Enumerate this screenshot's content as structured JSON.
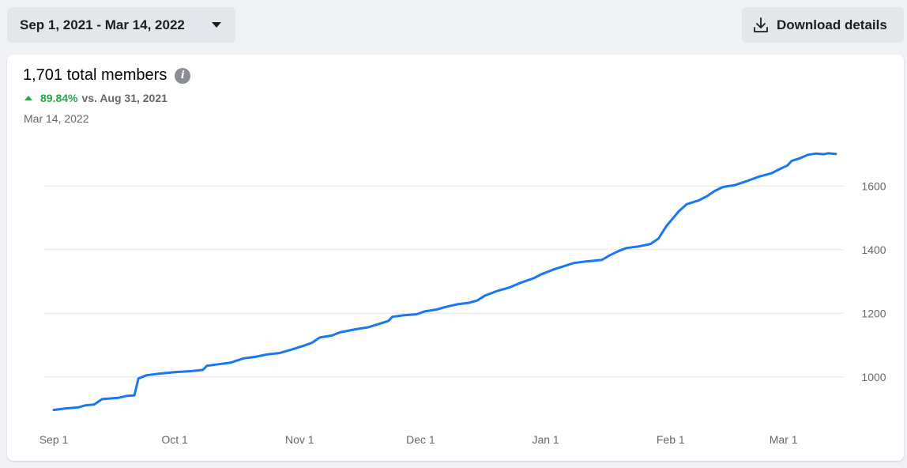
{
  "header": {
    "date_range": "Sep 1, 2021 - Mar 14, 2022",
    "download_label": "Download details"
  },
  "summary": {
    "total": "1,701 total members",
    "change_pct": "89.84%",
    "change_vs": "vs. Aug 31, 2021",
    "as_of": "Mar 14, 2022"
  },
  "icons": {
    "dropdown": "caret-down-icon",
    "download": "download-icon",
    "info": "info-icon",
    "trend": "up-arrow-icon"
  },
  "colors": {
    "line": "#1877f2",
    "positive": "#31a24c",
    "grid": "#e4e6eb"
  },
  "chart_data": {
    "type": "line",
    "title": "",
    "xlabel": "",
    "ylabel": "",
    "x_ticks": [
      "Sep 1",
      "Oct 1",
      "Nov 1",
      "Dec 1",
      "Jan 1",
      "Feb 1",
      "Mar 1"
    ],
    "y_ticks": [
      1000,
      1200,
      1400,
      1600
    ],
    "xlim": [
      "2021-09-01",
      "2022-03-14"
    ],
    "ylim": [
      895,
      1745
    ],
    "grid": true,
    "series": [
      {
        "name": "",
        "points": [
          [
            "2021-09-01",
            896
          ],
          [
            "2021-09-04",
            901
          ],
          [
            "2021-09-07",
            904
          ],
          [
            "2021-09-09",
            911
          ],
          [
            "2021-09-11",
            913
          ],
          [
            "2021-09-13",
            930
          ],
          [
            "2021-09-17",
            934
          ],
          [
            "2021-09-19",
            940
          ],
          [
            "2021-09-21",
            942
          ],
          [
            "2021-09-22",
            995
          ],
          [
            "2021-09-24",
            1005
          ],
          [
            "2021-09-27",
            1010
          ],
          [
            "2021-10-01",
            1015
          ],
          [
            "2021-10-05",
            1018
          ],
          [
            "2021-10-08",
            1022
          ],
          [
            "2021-10-09",
            1035
          ],
          [
            "2021-10-12",
            1040
          ],
          [
            "2021-10-15",
            1045
          ],
          [
            "2021-10-18",
            1058
          ],
          [
            "2021-10-21",
            1063
          ],
          [
            "2021-10-24",
            1071
          ],
          [
            "2021-10-27",
            1075
          ],
          [
            "2021-10-30",
            1086
          ],
          [
            "2021-11-02",
            1098
          ],
          [
            "2021-11-04",
            1107
          ],
          [
            "2021-11-06",
            1124
          ],
          [
            "2021-11-09",
            1130
          ],
          [
            "2021-11-11",
            1140
          ],
          [
            "2021-11-15",
            1150
          ],
          [
            "2021-11-18",
            1156
          ],
          [
            "2021-11-21",
            1168
          ],
          [
            "2021-11-23",
            1176
          ],
          [
            "2021-11-24",
            1189
          ],
          [
            "2021-11-27",
            1194
          ],
          [
            "2021-11-30",
            1197
          ],
          [
            "2021-12-02",
            1206
          ],
          [
            "2021-12-05",
            1212
          ],
          [
            "2021-12-07",
            1219
          ],
          [
            "2021-12-10",
            1228
          ],
          [
            "2021-12-13",
            1233
          ],
          [
            "2021-12-15",
            1240
          ],
          [
            "2021-12-17",
            1256
          ],
          [
            "2021-12-20",
            1270
          ],
          [
            "2021-12-23",
            1281
          ],
          [
            "2021-12-26",
            1297
          ],
          [
            "2021-12-29",
            1310
          ],
          [
            "2021-12-31",
            1323
          ],
          [
            "2022-01-03",
            1338
          ],
          [
            "2022-01-06",
            1350
          ],
          [
            "2022-01-08",
            1358
          ],
          [
            "2022-01-11",
            1363
          ],
          [
            "2022-01-15",
            1368
          ],
          [
            "2022-01-17",
            1383
          ],
          [
            "2022-01-19",
            1395
          ],
          [
            "2022-01-21",
            1405
          ],
          [
            "2022-01-24",
            1410
          ],
          [
            "2022-01-27",
            1418
          ],
          [
            "2022-01-29",
            1435
          ],
          [
            "2022-01-31",
            1475
          ],
          [
            "2022-02-03",
            1520
          ],
          [
            "2022-02-05",
            1543
          ],
          [
            "2022-02-08",
            1555
          ],
          [
            "2022-02-10",
            1568
          ],
          [
            "2022-02-12",
            1585
          ],
          [
            "2022-02-14",
            1597
          ],
          [
            "2022-02-17",
            1603
          ],
          [
            "2022-02-20",
            1616
          ],
          [
            "2022-02-23",
            1630
          ],
          [
            "2022-02-26",
            1640
          ],
          [
            "2022-02-28",
            1653
          ],
          [
            "2022-03-02",
            1665
          ],
          [
            "2022-03-03",
            1679
          ],
          [
            "2022-03-05",
            1687
          ],
          [
            "2022-03-07",
            1698
          ],
          [
            "2022-03-09",
            1702
          ],
          [
            "2022-03-11",
            1700
          ],
          [
            "2022-03-12",
            1703
          ],
          [
            "2022-03-14",
            1701
          ]
        ]
      }
    ]
  }
}
